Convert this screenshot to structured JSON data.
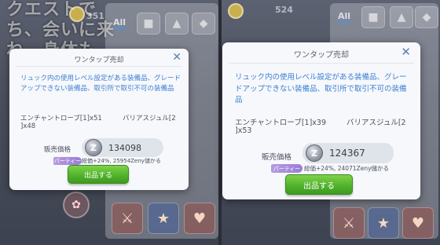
{
  "background": {
    "left_caption_line1": "クエストで",
    "left_caption_line2": "ち、会いに来",
    "left_caption_line3": "ね。身体も",
    "left_counter": "351",
    "right_counter": "524",
    "tab_all": "All"
  },
  "dialog_left": {
    "title": "ワンタップ売却",
    "description": "リュック内の使用レベル設定がある装備品、グレードアップできない装備品、取引所で取引不可の装備品",
    "item1": "エンチャントローブ[1]x51",
    "item2_a": "バリアスジュル[2",
    "item2_b": "]x48",
    "price_label": "販売価格",
    "coin_symbol": "Z",
    "price_value": "134098",
    "party_badge": "パーティー",
    "bonus_text": "総価+24%, 25954Zeny儲かる",
    "sell_button": "出品する"
  },
  "dialog_right": {
    "title": "ワンタップ売却",
    "description": "リュック内の使用レベル設定がある装備品、グレードアップできない装備品、取引所で取引不可の装備品",
    "item1": "エンチャントローブ[1]x39",
    "item2_a": "バリアスジュル[2",
    "item2_b": "]x53",
    "price_label": "販売価格",
    "coin_symbol": "Z",
    "price_value": "124367",
    "party_badge": "パーティー",
    "bonus_text": "総価+24%, 24071Zeny儲かる",
    "sell_button": "出品する"
  }
}
